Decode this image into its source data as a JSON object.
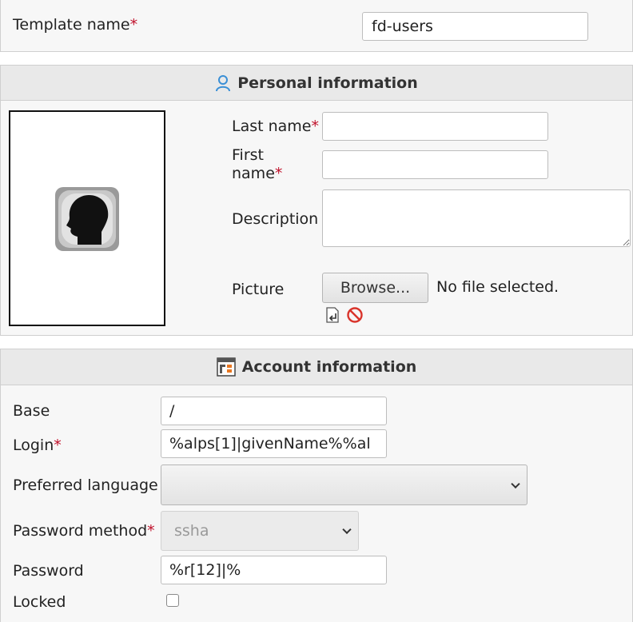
{
  "template": {
    "label": "Template name",
    "required_mark": "*",
    "value": "fd-users"
  },
  "personal": {
    "header": "Personal information",
    "header_icon": "user-icon",
    "last_name_label": "Last name",
    "first_name_label_line1": "First",
    "first_name_label_line2": "name",
    "description_label": "Description",
    "picture_label": "Picture",
    "browse_label": "Browse...",
    "no_file_text": "No file selected.",
    "last_name_value": "",
    "first_name_value": "",
    "description_value": "",
    "required_mark": "*"
  },
  "account": {
    "header": "Account information",
    "header_icon": "account-card-icon",
    "base_label": "Base",
    "base_value": "/",
    "login_label": "Login",
    "login_value": "%alps[1]|givenName%%al",
    "language_label": "Preferred language",
    "language_value": "",
    "password_method_label": "Password method",
    "password_method_value": "ssha",
    "password_label": "Password",
    "password_value": "%r[12]|%",
    "locked_label": "Locked",
    "locked_checked": false,
    "required_mark": "*"
  },
  "colors": {
    "required": "#c0102a",
    "header_bg": "#e9e9e9",
    "section_bg": "#f7f7f7",
    "icon_blue": "#3a8fd6",
    "icon_orange": "#e87722",
    "cancel_red": "#d9342b"
  }
}
